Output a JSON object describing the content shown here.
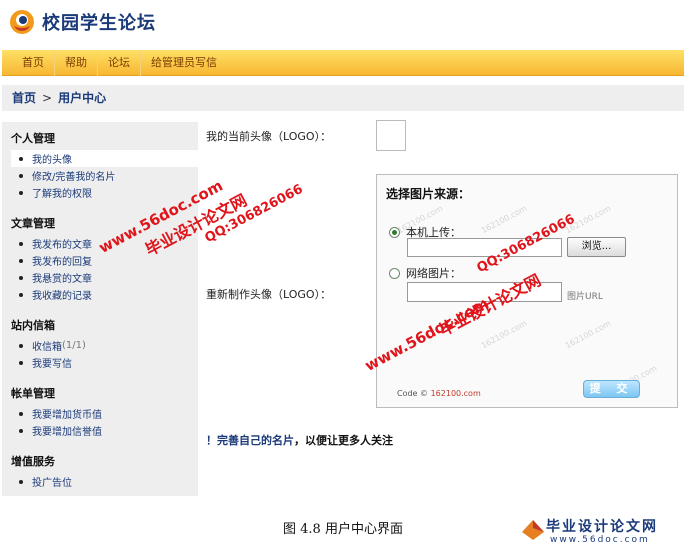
{
  "header": {
    "site_name": "校园学生论坛"
  },
  "nav": {
    "items": [
      "首页",
      "帮助",
      "论坛",
      "给管理员写信"
    ]
  },
  "breadcrumb": {
    "home": "首页",
    "separator": ">",
    "current": "用户中心"
  },
  "sidebar": {
    "groups": [
      {
        "title": "个人管理",
        "items": [
          {
            "label": "我的头像"
          },
          {
            "label": "修改/完善我的名片"
          },
          {
            "label": "了解我的权限"
          }
        ]
      },
      {
        "title": "文章管理",
        "items": [
          {
            "label": "我发布的文章"
          },
          {
            "label": "我发布的回复"
          },
          {
            "label": "我悬赏的文章"
          },
          {
            "label": "我收藏的记录"
          }
        ]
      },
      {
        "title": "站内信箱",
        "items": [
          {
            "label": "收信箱",
            "count": "(1/1)"
          },
          {
            "label": "我要写信"
          }
        ]
      },
      {
        "title": "帐单管理",
        "items": [
          {
            "label": "我要增加货币值"
          },
          {
            "label": "我要增加信誉值"
          }
        ]
      },
      {
        "title": "增值服务",
        "items": [
          {
            "label": "投广告位"
          }
        ]
      }
    ]
  },
  "main": {
    "current_avatar_label": "我的当前头像（LOGO）：",
    "remake_avatar_label": "重新制作头像（LOGO）：",
    "upload": {
      "title": "选择图片来源：",
      "local_label": "本机上传：",
      "browse_label": "浏览...",
      "network_label": "网络图片：",
      "url_hint": "图片URL",
      "code_by_prefix": "Code ©",
      "code_by_link": "162100.com",
      "submit_label": "提 交",
      "faint_mark": "162100.com"
    },
    "notice_prefix": "！完善自己的名片",
    "notice_rest": "，以便让更多人关注"
  },
  "caption": "图 4.8 用户中心界面",
  "watermarks": {
    "brand": "毕业设计论文网",
    "url": "www.56doc.com",
    "qq": "QQ:306826066",
    "footer_url": "www.56doc.com"
  },
  "colors": {
    "accent": "#1b3a7a",
    "nav": "#f7b733",
    "watermark": "#e0151b"
  }
}
